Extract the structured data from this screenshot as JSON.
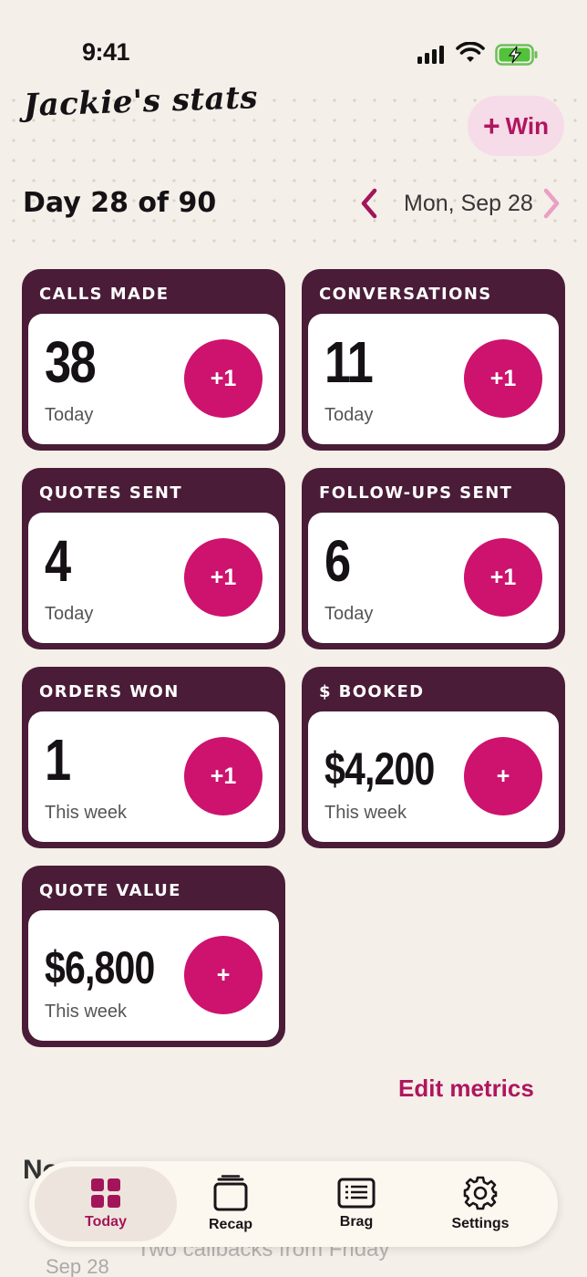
{
  "status_bar": {
    "time": "9:41"
  },
  "header": {
    "title": "Jackie's stats",
    "win_button": {
      "plus": "+",
      "label": "Win"
    },
    "day_label": "Day 28 of 90",
    "date": "Mon, Sep 28"
  },
  "metrics": [
    {
      "label": "CALLS MADE",
      "value": "38",
      "period": "Today",
      "button": "+1"
    },
    {
      "label": "CONVERSATIONS",
      "value": "11",
      "period": "Today",
      "button": "+1"
    },
    {
      "label": "QUOTES SENT",
      "value": "4",
      "period": "Today",
      "button": "+1"
    },
    {
      "label": "FOLLOW-UPS SENT",
      "value": "6",
      "period": "Today",
      "button": "+1"
    },
    {
      "label": "ORDERS WON",
      "value": "1",
      "period": "This week",
      "button": "+1"
    },
    {
      "label": "$ BOOKED",
      "value": "$4,200",
      "period": "This week",
      "button": "+"
    },
    {
      "label": "QUOTE VALUE",
      "value": "$6,800",
      "period": "This week",
      "button": "+"
    }
  ],
  "edit_metrics": "Edit metrics",
  "notes": {
    "title": "No",
    "date": "Sep 28",
    "text": "Two callbacks from Friday"
  },
  "tabs": [
    {
      "label": "Today",
      "icon": "grid-icon",
      "active": true
    },
    {
      "label": "Recap",
      "icon": "stack-icon"
    },
    {
      "label": "Brag",
      "icon": "list-icon"
    },
    {
      "label": "Settings",
      "icon": "gear-icon"
    }
  ],
  "colors": {
    "accent": "#cd136e",
    "card": "#4a1c37",
    "background": "#f4efe8",
    "link": "#b0155f"
  }
}
